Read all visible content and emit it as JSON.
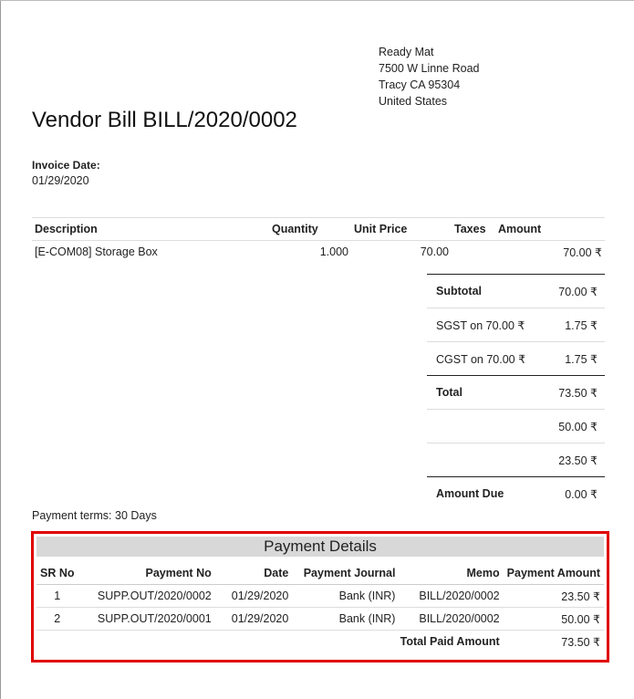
{
  "vendor_address": [
    "Ready Mat",
    "7500 W Linne Road",
    "Tracy CA 95304",
    "United States"
  ],
  "title": "Vendor Bill BILL/2020/0002",
  "invoice_date_label": "Invoice Date:",
  "invoice_date": "01/29/2020",
  "lines_header": {
    "description": "Description",
    "quantity": "Quantity",
    "unit_price": "Unit Price",
    "taxes": "Taxes",
    "amount": "Amount"
  },
  "lines": [
    {
      "description": "[E-COM08] Storage Box",
      "quantity": "1.000",
      "unit_price": "70.00",
      "taxes": "",
      "amount": "70.00 ₹"
    }
  ],
  "totals": [
    {
      "label": "Subtotal",
      "value": "70.00 ₹"
    },
    {
      "label": "SGST  on 70.00 ₹",
      "value": "1.75 ₹"
    },
    {
      "label": "CGST  on 70.00 ₹",
      "value": "1.75 ₹"
    },
    {
      "label": "Total",
      "value": "73.50 ₹"
    },
    {
      "label": "",
      "value": "50.00 ₹"
    },
    {
      "label": "",
      "value": "23.50 ₹"
    },
    {
      "label": "Amount Due",
      "value": "0.00 ₹"
    }
  ],
  "payment_terms": "Payment terms: 30 Days",
  "payment_details": {
    "heading": "Payment Details",
    "columns": {
      "sr_no": "SR No",
      "payment_no": "Payment No",
      "date": "Date",
      "journal": "Payment Journal",
      "memo": "Memo",
      "amount": "Payment Amount"
    },
    "rows": [
      {
        "sr_no": "1",
        "payment_no": "SUPP.OUT/2020/0002",
        "date": "01/29/2020",
        "journal": "Bank (INR)",
        "memo": "BILL/2020/0002",
        "amount": "23.50 ₹"
      },
      {
        "sr_no": "2",
        "payment_no": "SUPP.OUT/2020/0001",
        "date": "01/29/2020",
        "journal": "Bank (INR)",
        "memo": "BILL/2020/0002",
        "amount": "50.00 ₹"
      }
    ],
    "total_label": "Total Paid Amount",
    "total_value": "73.50 ₹"
  }
}
